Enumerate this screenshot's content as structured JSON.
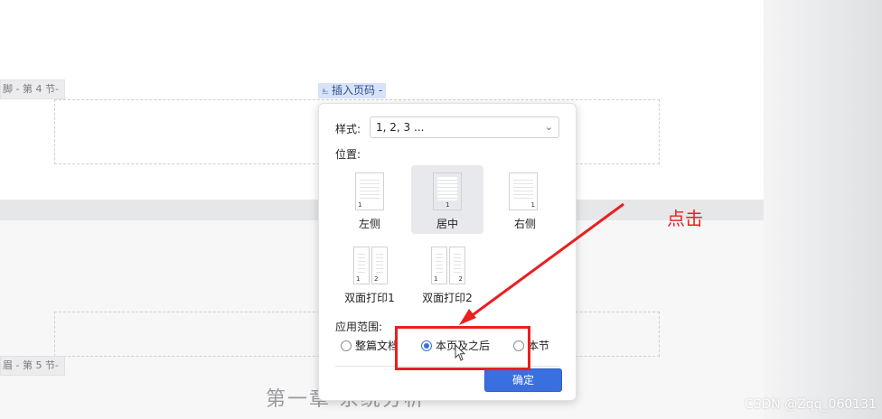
{
  "document": {
    "section4_tab": "- 第 4 节-",
    "section4_tab_prefix": "脚",
    "section5_tab": "- 第 5 节-",
    "section5_tab_prefix": "眉",
    "insert_page_number_tag": "插入页码 -",
    "chapter_title": "第一章 系统分析"
  },
  "dialog": {
    "style_label": "样式:",
    "style_value": "1, 2, 3 ...",
    "position_label": "位置:",
    "positions": [
      {
        "label": "左侧",
        "selected": false
      },
      {
        "label": "居中",
        "selected": true
      },
      {
        "label": "右侧",
        "selected": false
      },
      {
        "label": "双面打印1",
        "selected": false
      },
      {
        "label": "双面打印2",
        "selected": false
      }
    ],
    "scope_label": "应用范围:",
    "scope_options": [
      {
        "label": "整篇文档",
        "selected": false
      },
      {
        "label": "本页及之后",
        "selected": true
      },
      {
        "label": "本节",
        "selected": false
      }
    ],
    "confirm_button": "确定"
  },
  "annotation": {
    "text": "点击",
    "color": "#ea1f1f"
  },
  "watermark": "CSDN @Zqq_060131",
  "colors": {
    "accent": "#3a6fe0",
    "annotation_red": "#ea1f1f"
  }
}
